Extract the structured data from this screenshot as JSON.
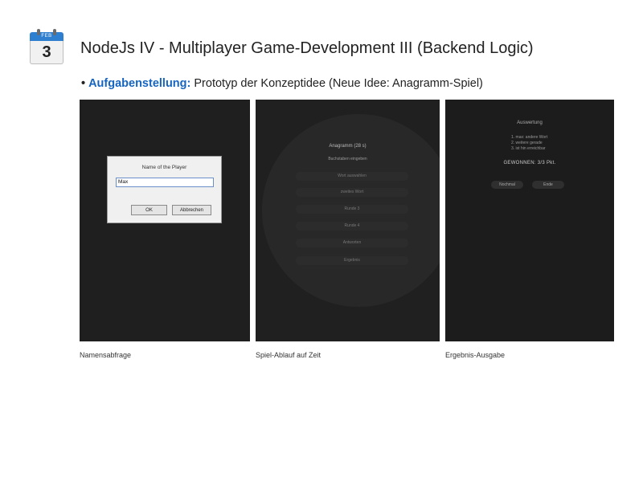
{
  "calendar": {
    "month": "FEB",
    "day": "3"
  },
  "title": "NodeJs IV - Multiplayer Game-Development III (Backend Logic)",
  "bullet": {
    "dot": "•",
    "key": "Aufgabenstellung:",
    "text": " Prototyp der Konzeptidee (Neue Idee: Anagramm-Spiel)"
  },
  "screens": [
    {
      "caption": "Namensabfrage",
      "dialog": {
        "label": "Name of the Player",
        "input_value": "Max",
        "ok": "OK",
        "cancel": "Abbrechen"
      }
    },
    {
      "caption": "Spiel-Ablauf auf Zeit",
      "menu_title": "Anagramm (28 s)",
      "menu_subtitle": "Buchstaben eingeben",
      "rows": [
        "Wort auswahlen",
        "zweites Wort",
        "Runde 3",
        "Runde 4",
        "Antworten",
        "Ergebnis"
      ]
    },
    {
      "caption": "Ergebnis-Ausgabe",
      "result_title": "Auswertung",
      "items": [
        "1. max: andere Wort",
        "2. weitere gerade",
        "3. ist hin erreichbar"
      ],
      "total": "GEWONNEN: 3/3 Pkt.",
      "buttons": [
        "Nochmal",
        "Ende"
      ]
    }
  ]
}
